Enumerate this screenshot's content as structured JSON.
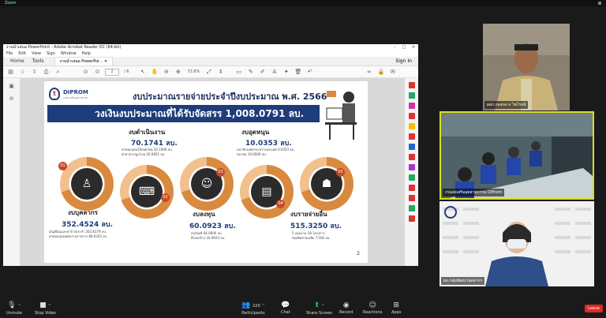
{
  "zoom": {
    "top_label": "Zoom",
    "bottom": {
      "unmute": "Unmute",
      "stop_video": "Stop Video",
      "participants": "Participants",
      "participants_count": "220",
      "chat": "Chat",
      "share_screen": "Share Screen",
      "record": "Record",
      "reactions": "Reactions",
      "apps": "Apps",
      "leave": "Leave"
    },
    "colors": {
      "share_green": "#22c55e",
      "leave_red": "#e02828",
      "active_speaker": "#d7df20"
    }
  },
  "acrobat": {
    "window_title": "งานนำเสนอ PowerPoint - Adobe Acrobat Reader DC (64-bit)",
    "menu": [
      "File",
      "Edit",
      "View",
      "Sign",
      "Window",
      "Help"
    ],
    "tabs": {
      "home": "Home",
      "tools": "Tools",
      "document": "งานนำเสนอ PowerPoi..."
    },
    "sign_in": "Sign In",
    "page_current": "2",
    "page_total": "/ 6",
    "zoom_level": "72.6%"
  },
  "slide": {
    "logo_text": "DIPROM",
    "logo_sub": "กรมส่งเสริมอุตสาหกรรม",
    "title": "งบประมาณรายจ่ายประจำปีงบประมาณ พ.ศ. 2566",
    "banner": "วงเงินงบประมาณที่ได้รับจัดสรร 1,008.0791 ลบ.",
    "groups": [
      {
        "num": "01",
        "label": "งบบุคลากร",
        "value": "352.4524 ลบ.",
        "note1": "เงินเดือนและค่าจ้างประจำ 262.8179 ลบ.",
        "note2": "ค่าตอบแทนพนักงานราชการ 89.6325 ลบ."
      },
      {
        "num": "02",
        "label": "งบดำเนินงาน",
        "value": "70.1741 ลบ.",
        "note1": "ค่าตอบแทนใช้สอยวัสดุ 50.1090 ลบ.",
        "note2": "ค่าสาธารณูปโภค 20.0651 ลบ."
      },
      {
        "num": "03",
        "label": "งบลงทุน",
        "value": "60.0923 ลบ.",
        "note1": "ครุภัณฑ์ 44.0000 ลบ.",
        "note2": "สิ่งก่อสร้าง 16.0923 ลบ."
      },
      {
        "num": "04",
        "label": "งบอุดหนุน",
        "value": "10.0353 ลบ.",
        "note1": "สมาชิกองค์กรระหว่างประเทศ 0.0353 ลบ.",
        "note2": "สมาคม 10.0000 ลบ."
      },
      {
        "num": "05",
        "label": "งบรายจ่ายอื่น",
        "value": "515.3250 ลบ.",
        "note1": "5 แผนงาน 18 โครงการ",
        "note2": "บัณฑิตช่วยเหลือ 7,500 ลบ."
      }
    ],
    "page_number": "2"
  },
  "participants": [
    {
      "name": "ผอก.กองกลาง ไพโรจน์"
    },
    {
      "name": "กรมส่งเสริมอุตสาหกรรม DIProm"
    },
    {
      "name": "ผอ.กลุ่มพัฒนาบุคลากร"
    }
  ]
}
